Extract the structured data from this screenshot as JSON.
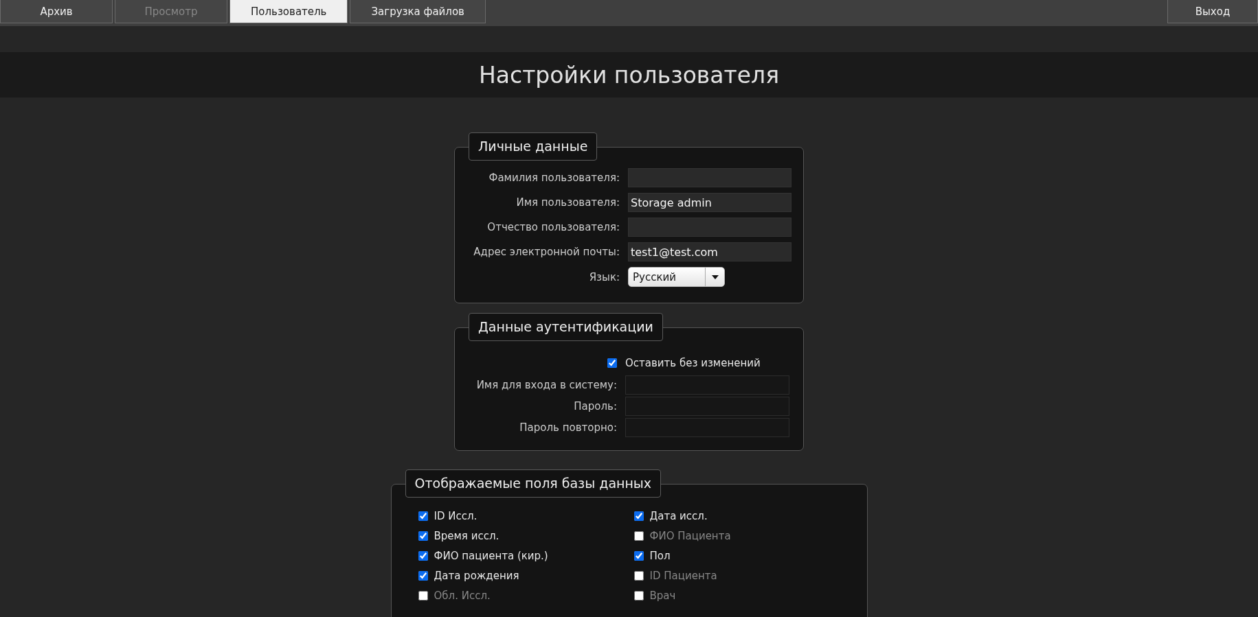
{
  "nav": {
    "tabs": [
      {
        "label": "Архив",
        "selected": false,
        "disabled": false
      },
      {
        "label": "Просмотр",
        "selected": false,
        "disabled": true
      },
      {
        "label": "Пользователь",
        "selected": true,
        "disabled": false
      },
      {
        "label": "Загрузка файлов",
        "selected": false,
        "disabled": false
      }
    ],
    "logout": "Выход"
  },
  "page_title": "Настройки пользователя",
  "personal": {
    "legend": "Личные данные",
    "fields": [
      {
        "label": "Фамилия пользователя:"
      },
      {
        "label": "Имя пользователя:",
        "value": "Storage admin"
      },
      {
        "label": "Отчество пользователя:"
      },
      {
        "label": "Адрес электронной почты:",
        "value": "test1@test.com"
      }
    ],
    "language": {
      "label": "Язык:",
      "value": "Русский"
    }
  },
  "auth": {
    "legend": "Данные аутентификации",
    "keep_unchanged": {
      "label": "Оставить без изменений",
      "checked": true
    },
    "fields": [
      {
        "label": "Имя для входа в систему:"
      },
      {
        "label": "Пароль:"
      },
      {
        "label": "Пароль повторно:"
      }
    ]
  },
  "db_fields": {
    "legend": "Отображаемые поля базы данных",
    "items": [
      {
        "label": "ID Иссл.",
        "checked": true
      },
      {
        "label": "Дата иссл.",
        "checked": true
      },
      {
        "label": "Время иссл.",
        "checked": true
      },
      {
        "label": "ФИО Пациента",
        "checked": false
      },
      {
        "label": "ФИО пациента (кир.)",
        "checked": true
      },
      {
        "label": "Пол",
        "checked": true
      },
      {
        "label": "Дата рождения",
        "checked": true
      },
      {
        "label": "ID Пациента",
        "checked": false
      },
      {
        "label": "Обл. Иссл.",
        "checked": false
      },
      {
        "label": "Врач",
        "checked": false
      }
    ]
  }
}
